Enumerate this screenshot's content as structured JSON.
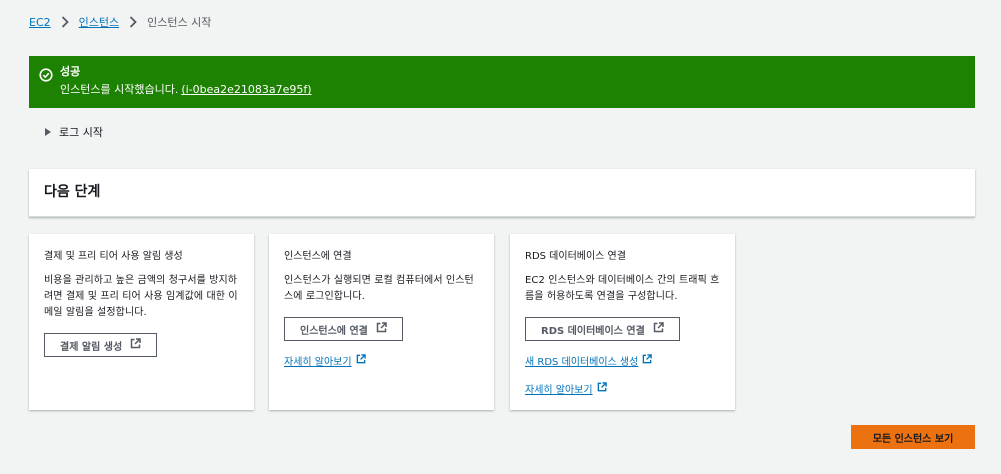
{
  "breadcrumb": {
    "items": [
      "EC2",
      "인스턴스"
    ],
    "current": "인스턴스 시작"
  },
  "flash": {
    "title": "성공",
    "message": "인스턴스를 시작했습니다.",
    "instance_id": "(i-0bea2e21083a7e95f)",
    "color": "#1d8102"
  },
  "log_toggle": {
    "label": "로그 시작"
  },
  "next_steps": {
    "title": "다음 단계"
  },
  "cards": [
    {
      "title": "결제 및 프리 티어 사용 알림 생성",
      "body": "비용을 관리하고 높은 금액의 청구서를 방지하려면 결제 및 프리 티어 사용 임계값에 대한 이메일 알림을 설정합니다.",
      "button": "결제 알림 생성"
    },
    {
      "title": "인스턴스에 연결",
      "body": "인스턴스가 실행되면 로컬 컴퓨터에서 인스턴스에 로그인합니다.",
      "button": "인스턴스에 연결",
      "link": "자세히 알아보기"
    },
    {
      "title": "RDS 데이터베이스 연결",
      "body": "EC2 인스턴스와 데이터베이스 간의 트래픽 흐름을 허용하도록 연결을 구성합니다.",
      "button": "RDS 데이터베이스 연결",
      "links": [
        "새 RDS 데이터베이스 생성",
        "자세히 알아보기"
      ]
    }
  ],
  "primary_button": {
    "label": "모든 인스턴스 보기",
    "color": "#ec7211"
  }
}
